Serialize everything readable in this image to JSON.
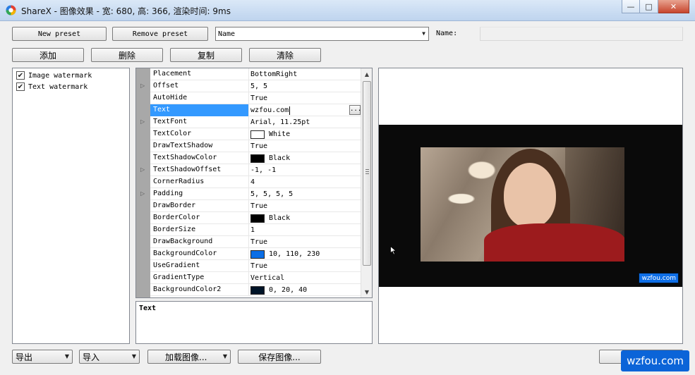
{
  "window": {
    "title": "ShareX - 图像效果 - 宽: 680, 高: 366, 渲染时间: 9ms",
    "minimize_glyph": "—",
    "maximize_glyph": "□",
    "close_glyph": "✕"
  },
  "toolbar": {
    "new_preset": "New preset",
    "remove_preset": "Remove preset",
    "preset_select_value": "Name",
    "name_label": "Name:",
    "add": "添加",
    "delete": "删除",
    "copy": "复制",
    "clear": "清除"
  },
  "effects": [
    {
      "label": "Image watermark",
      "checked": true
    },
    {
      "label": "Text watermark",
      "checked": true
    }
  ],
  "check_glyph": "✔",
  "properties": [
    {
      "name": "Placement",
      "value": "BottomRight"
    },
    {
      "name": "Offset",
      "value": "5, 5",
      "expandable": true
    },
    {
      "name": "AutoHide",
      "value": "True"
    },
    {
      "name": "Text",
      "value": "wzfou.com",
      "selected": true,
      "ellipsis": "..."
    },
    {
      "name": "TextFont",
      "value": "Arial, 11.25pt",
      "expandable": true
    },
    {
      "name": "TextColor",
      "value": "White",
      "color": "#ffffff"
    },
    {
      "name": "DrawTextShadow",
      "value": "True"
    },
    {
      "name": "TextShadowColor",
      "value": "Black",
      "color": "#000000"
    },
    {
      "name": "TextShadowOffset",
      "value": "-1, -1",
      "expandable": true
    },
    {
      "name": "CornerRadius",
      "value": "4"
    },
    {
      "name": "Padding",
      "value": "5, 5, 5, 5",
      "expandable": true
    },
    {
      "name": "DrawBorder",
      "value": "True"
    },
    {
      "name": "BorderColor",
      "value": "Black",
      "color": "#000000"
    },
    {
      "name": "BorderSize",
      "value": "1"
    },
    {
      "name": "DrawBackground",
      "value": "True"
    },
    {
      "name": "BackgroundColor",
      "value": "10, 110, 230",
      "color": "#0a6ee6"
    },
    {
      "name": "UseGradient",
      "value": "True"
    },
    {
      "name": "GradientType",
      "value": "Vertical"
    },
    {
      "name": "BackgroundColor2",
      "value": "0, 20, 40",
      "color": "#001428"
    }
  ],
  "expander_glyph": "▷",
  "description": {
    "title": "Text"
  },
  "preview": {
    "watermark_text": "wzfou.com"
  },
  "bottom": {
    "export": "导出",
    "import": "导入",
    "load_image": "加载图像...",
    "save_image": "保存图像...",
    "site_watermark": "wzfou.com"
  },
  "scroll": {
    "up": "▲",
    "down": "▼"
  },
  "colors": {
    "selection": "#3399ff",
    "gutter": "#a8a8a8",
    "watermark_bg": "#0a6ee6"
  }
}
